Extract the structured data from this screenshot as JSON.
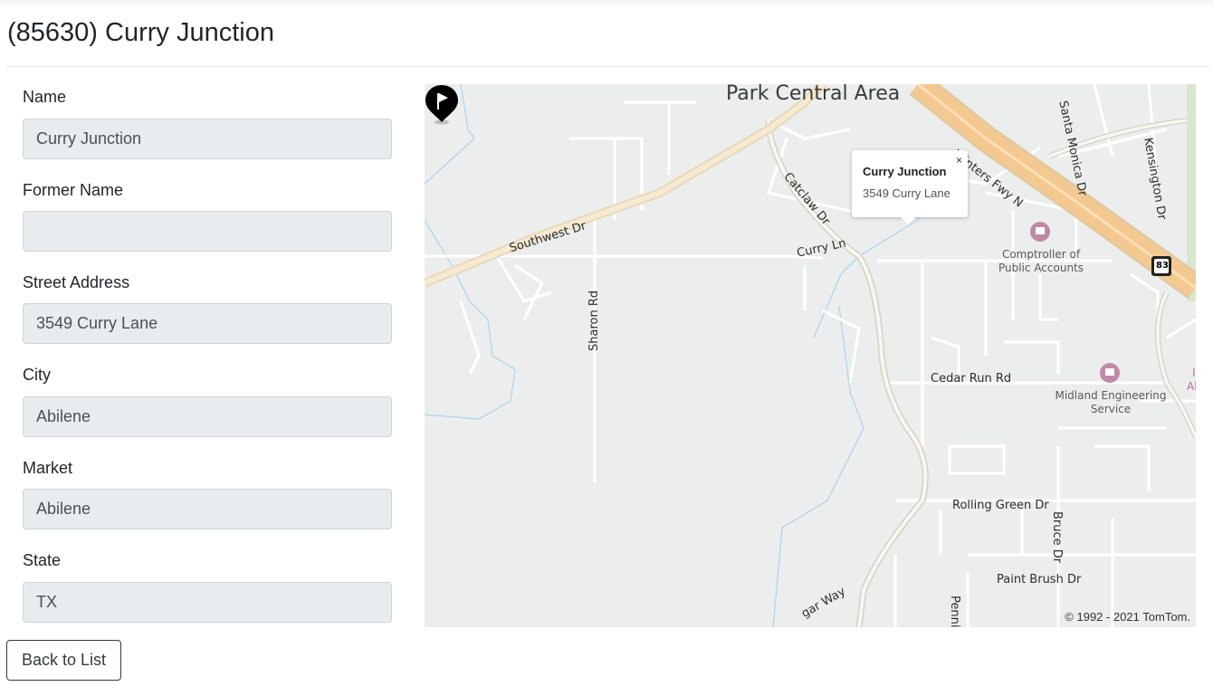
{
  "page": {
    "title": "(85630) Curry Junction"
  },
  "form": {
    "name": {
      "label": "Name",
      "value": "Curry Junction"
    },
    "former_name": {
      "label": "Former Name",
      "value": ""
    },
    "street_address": {
      "label": "Street Address",
      "value": "3549 Curry Lane"
    },
    "city": {
      "label": "City",
      "value": "Abilene"
    },
    "market": {
      "label": "Market",
      "value": "Abilene"
    },
    "state": {
      "label": "State",
      "value": "TX"
    }
  },
  "map": {
    "area_label": "Park Central Area",
    "roads": {
      "winters_fwy": "Winters Fwy N",
      "southwest_dr": "Southwest Dr",
      "catclaw_dr": "Catclaw Dr",
      "curry_ln": "Curry Ln",
      "sharon_rd": "Sharon Rd",
      "santa_monica_dr": "Santa Monica Dr",
      "kensington_dr": "Kensington Dr",
      "cedar_run_rd": "Cedar Run Rd",
      "rolling_green_dr": "Rolling Green Dr",
      "bruce_dr": "Bruce Dr",
      "paint_brush_dr": "Paint Brush Dr",
      "cougar_way": "gar Way",
      "penn": "Penni"
    },
    "pois": {
      "comptroller_line1": "Comptroller of",
      "comptroller_line2": "Public Accounts",
      "midland_line1": "Midland Engineering",
      "midland_line2": "Service",
      "edge_label1": "I",
      "edge_label2": "Ab"
    },
    "highway_shield": "83",
    "popup": {
      "title": "Curry Junction",
      "address": "3549 Curry Lane",
      "close": "×"
    },
    "marker_icon": "flag-marker-icon",
    "copyright": "© 1992 - 2021 TomTom."
  },
  "actions": {
    "back_label": "Back to List"
  },
  "colors": {
    "input_bg": "#e9ecef",
    "highway": "#f4c98f",
    "water": "#a8d4f0",
    "marker": "#000000"
  }
}
